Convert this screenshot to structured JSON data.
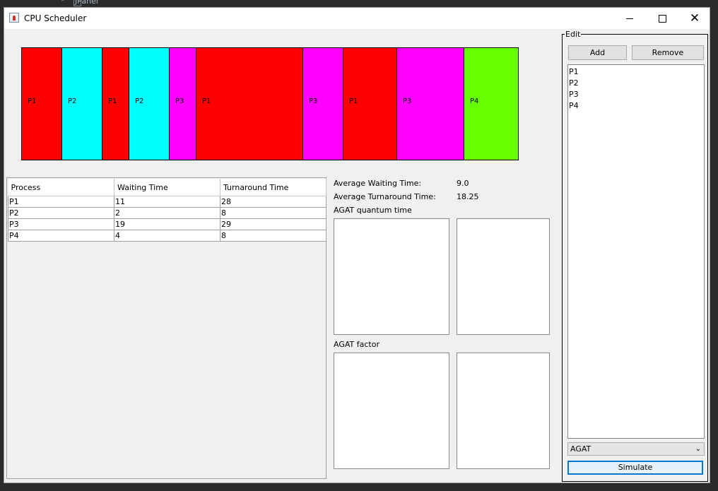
{
  "background_ide": {
    "text": "JPanel"
  },
  "window": {
    "title": "CPU Scheduler",
    "controls": {
      "minimize": "minimize",
      "maximize": "maximize",
      "close": "✕"
    }
  },
  "gantt": {
    "blocks": [
      {
        "label": "P1",
        "start": 0,
        "end": 3,
        "color": "#ff0000"
      },
      {
        "label": "P2",
        "start": 3,
        "end": 6,
        "color": "#00ffff"
      },
      {
        "label": "P1",
        "start": 6,
        "end": 8,
        "color": "#ff0000"
      },
      {
        "label": "P2",
        "start": 8,
        "end": 11,
        "color": "#00ffff"
      },
      {
        "label": "P3",
        "start": 11,
        "end": 13,
        "color": "#ff00ff"
      },
      {
        "label": "P1",
        "start": 13,
        "end": 21,
        "color": "#ff0000"
      },
      {
        "label": "P3",
        "start": 21,
        "end": 24,
        "color": "#ff00ff"
      },
      {
        "label": "P1",
        "start": 24,
        "end": 28,
        "color": "#ff0000"
      },
      {
        "label": "P3",
        "start": 28,
        "end": 33,
        "color": "#ff00ff"
      },
      {
        "label": "P4",
        "start": 33,
        "end": 37,
        "color": "#66ff00"
      }
    ]
  },
  "table": {
    "headers": [
      "Process",
      "Waiting Time",
      "Turnaround Time"
    ],
    "rows": [
      [
        "P1",
        "11",
        "28"
      ],
      [
        "P2",
        "2",
        "8"
      ],
      [
        "P3",
        "19",
        "29"
      ],
      [
        "P4",
        "4",
        "8"
      ]
    ]
  },
  "stats": {
    "avg_waiting_label": "Average Waiting Time:",
    "avg_waiting_value": "9.0",
    "avg_turnaround_label": "Average Turnaround Time:",
    "avg_turnaround_value": "18.25",
    "quantum_label": "AGAT quantum time",
    "factor_label": "AGAT factor"
  },
  "edit": {
    "legend": "Edit",
    "add_label": "Add",
    "remove_label": "Remove",
    "processes": [
      "P1",
      "P2",
      "P3",
      "P4"
    ],
    "algorithm": "AGAT",
    "simulate_label": "Simulate"
  }
}
